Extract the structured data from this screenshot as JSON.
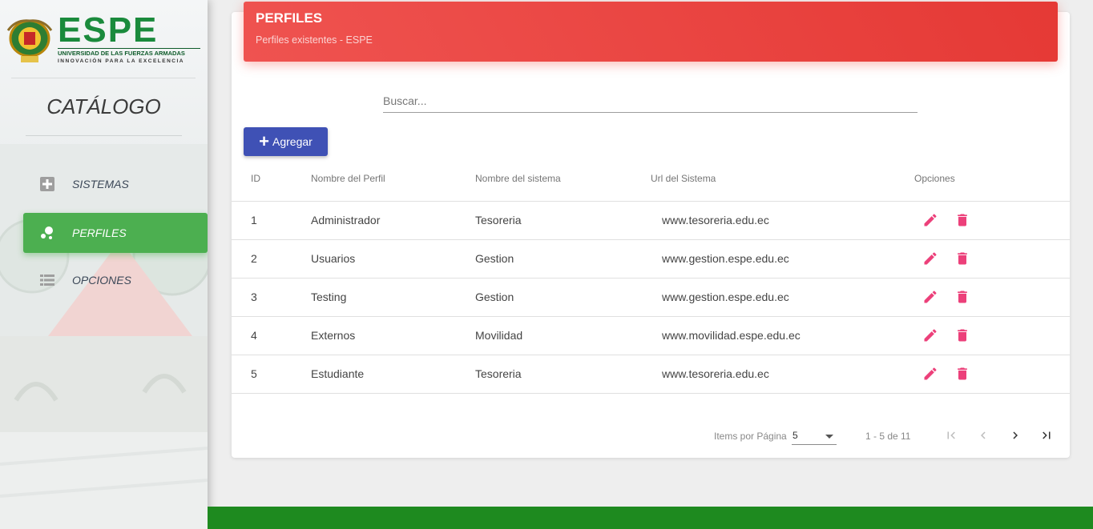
{
  "sidebar": {
    "logo": {
      "word": "ESPE",
      "line1": "UNIVERSIDAD DE LAS FUERZAS ARMADAS",
      "line2": "INNOVACIÓN PARA LA EXCELENCIA"
    },
    "title": "CATÁLOGO",
    "items": [
      {
        "label": "SISTEMAS",
        "icon": "plus-box-icon",
        "active": false
      },
      {
        "label": "PERFILES",
        "icon": "bubbles-icon",
        "active": true
      },
      {
        "label": "OPCIONES",
        "icon": "list-icon",
        "active": false
      }
    ]
  },
  "header": {
    "title": "PERFILES",
    "subtitle": "Perfiles existentes - ESPE",
    "color": "#ef5350"
  },
  "search": {
    "placeholder": "Buscar..."
  },
  "toolbar": {
    "add_label": "Agregar",
    "add_color": "#3f51b5"
  },
  "table": {
    "columns": [
      "ID",
      "Nombre del Perfil",
      "Nombre del sistema",
      "Url del Sistema",
      "Opciones"
    ],
    "rows": [
      {
        "id": "1",
        "perfil": "Administrador",
        "sistema": "Tesoreria",
        "url": "www.tesoreria.edu.ec"
      },
      {
        "id": "2",
        "perfil": "Usuarios",
        "sistema": "Gestion",
        "url": "www.gestion.espe.edu.ec"
      },
      {
        "id": "3",
        "perfil": "Testing",
        "sistema": "Gestion",
        "url": "www.gestion.espe.edu.ec"
      },
      {
        "id": "4",
        "perfil": "Externos",
        "sistema": "Movilidad",
        "url": "www.movilidad.espe.edu.ec"
      },
      {
        "id": "5",
        "perfil": "Estudiante",
        "sistema": "Tesoreria",
        "url": "www.tesoreria.edu.ec"
      }
    ],
    "action_color": "#ec407a"
  },
  "pager": {
    "items_label": "Items por Página",
    "page_size": "5",
    "range": "1 - 5 de 11"
  },
  "footer": {
    "color": "#1e8a1f"
  }
}
